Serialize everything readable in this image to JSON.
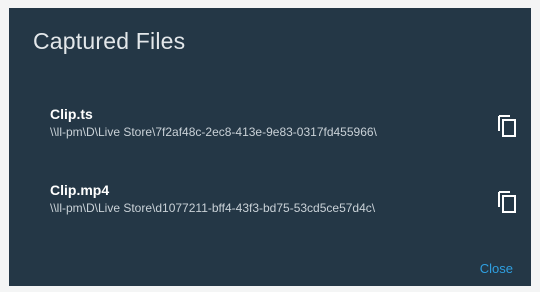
{
  "dialog": {
    "title": "Captured Files",
    "close_label": "Close"
  },
  "files": [
    {
      "name": "Clip.ts",
      "path": "\\\\ll-pm\\D\\Live Store\\7f2af48c-2ec8-413e-9e83-0317fd455966\\",
      "action_icon": "copy-icon"
    },
    {
      "name": "Clip.mp4",
      "path": "\\\\ll-pm\\D\\Live Store\\d1077211-bff4-43f3-bd75-53cd5ce57d4c\\",
      "action_icon": "copy-icon"
    }
  ],
  "colors": {
    "dialog_bg": "#243746",
    "title": "#e3e7ea",
    "path": "#c9d1d7",
    "accent": "#2f9fe0"
  }
}
